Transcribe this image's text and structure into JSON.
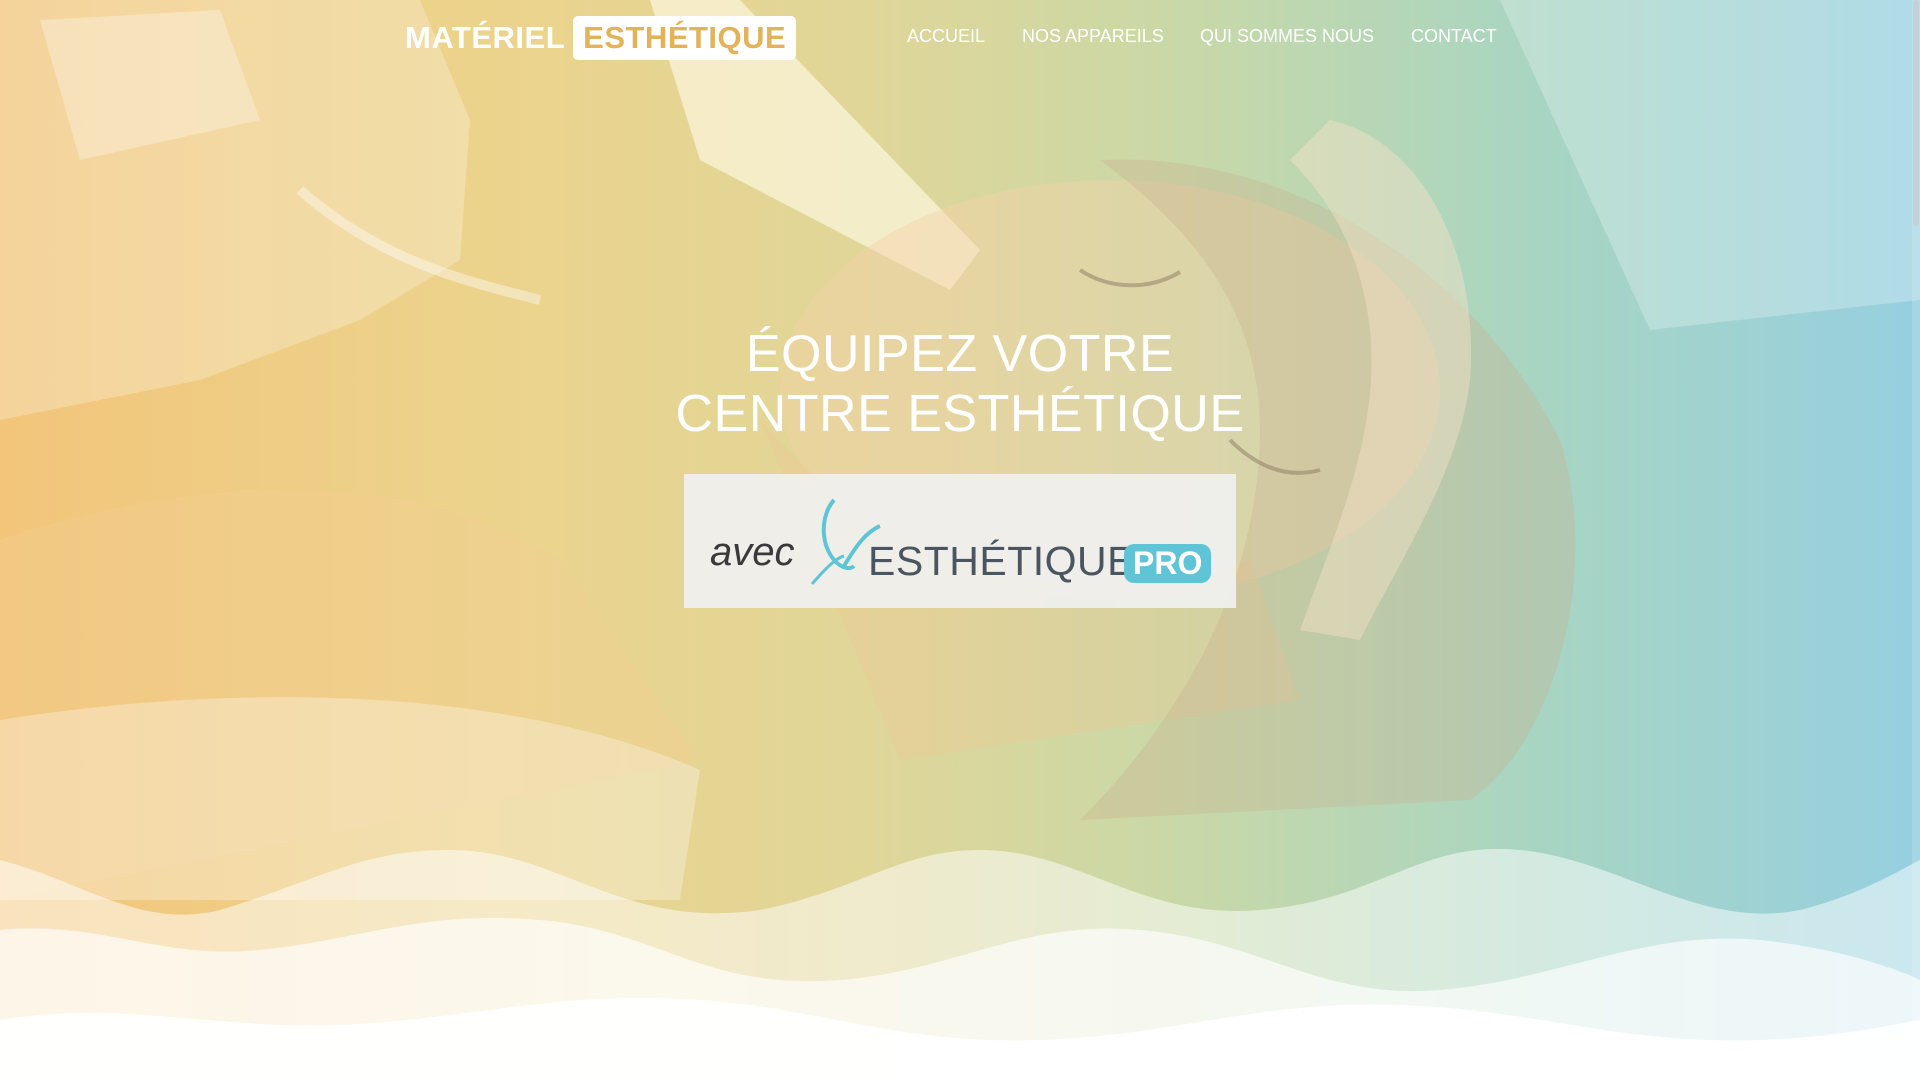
{
  "logo": {
    "left_text": "MATÉRIEL",
    "right_text": "ESTHÉTIQUE"
  },
  "nav": {
    "items": [
      "ACCUEIL",
      "NOS APPAREILS",
      "QUI SOMMES NOUS",
      "CONTACT"
    ]
  },
  "hero": {
    "headline_line1": "ÉQUIPEZ VOTRE",
    "headline_line2": "CENTRE ESTHÉTIQUE"
  },
  "brand": {
    "avec": "avec",
    "name": "ESTHÉTIQUE",
    "pro": "PRO"
  },
  "colors": {
    "gradient_left": "#f2c57a",
    "gradient_mid": "#e0d698",
    "gradient_right": "#96cfe0",
    "logo_accent": "#e2b35a",
    "pro_badge": "#5fc5d6",
    "white": "#ffffff"
  },
  "icons": {
    "brand_mark": "butterfly-icon"
  }
}
